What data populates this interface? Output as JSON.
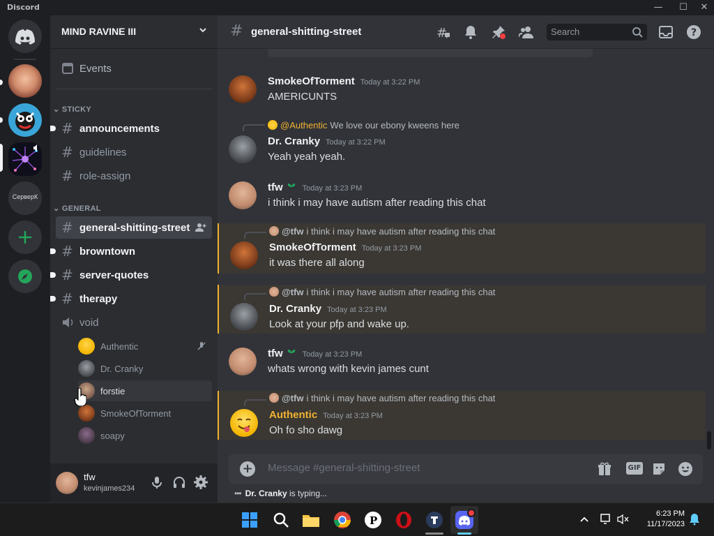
{
  "app": {
    "title": "Discord"
  },
  "window_controls": {
    "minimize": "—",
    "maximize": "☐",
    "close": "✕"
  },
  "guilds": [
    {
      "name": "Direct Messages",
      "icon": "discord-logo-icon"
    },
    {
      "name": "server-1",
      "icon": "avatar-face"
    },
    {
      "name": "server-2",
      "icon": "avatar-cartoon"
    },
    {
      "name": "server-3",
      "icon": "avatar-network"
    },
    {
      "name": "СерверК",
      "label": "СерверК"
    },
    {
      "name": "Add a Server",
      "icon": "plus-icon"
    },
    {
      "name": "Explore Servers",
      "icon": "compass-icon"
    }
  ],
  "server": {
    "name": "MIND RAVINE III"
  },
  "sidebar": {
    "events_label": "Events",
    "categories": [
      {
        "name": "STICKY",
        "channels": [
          "announcements",
          "guidelines",
          "role-assign"
        ]
      },
      {
        "name": "GENERAL",
        "channels": [
          "general-shitting-street",
          "browntown",
          "server-quotes",
          "therapy",
          "void"
        ]
      }
    ],
    "voice_users": [
      "Authentic",
      "Dr. Cranky",
      "forstie",
      "SmokeOfTorment",
      "soapy"
    ]
  },
  "user_panel": {
    "name": "tfw",
    "tag": "kevinjames234"
  },
  "channel": {
    "name": "general-shitting-street",
    "search_placeholder": "Search"
  },
  "messages": [
    {
      "author": "SmokeOfTorment",
      "time": "Today at 3:22 PM",
      "text": "AMERICUNTS"
    },
    {
      "reply_to": "@Authentic",
      "reply_text": "We love our ebony kweens here",
      "author": "Dr. Cranky",
      "time": "Today at 3:22 PM",
      "text": "Yeah yeah yeah."
    },
    {
      "author": "tfw",
      "time": "Today at 3:23 PM",
      "text": "i think i may have autism after reading this chat"
    },
    {
      "reply_to": "@tfw",
      "reply_text": "i think i may have autism after reading this chat",
      "author": "SmokeOfTorment",
      "time": "Today at 3:23 PM",
      "text": "it was there all along"
    },
    {
      "reply_to": "@tfw",
      "reply_text": "i think i may have autism after reading this chat",
      "author": "Dr. Cranky",
      "time": "Today at 3:23 PM",
      "text": "Look at your pfp and wake up."
    },
    {
      "author": "tfw",
      "time": "Today at 3:23 PM",
      "text": "whats wrong with kevin james cunt"
    },
    {
      "reply_to": "@tfw",
      "reply_text": "i think i may have autism after reading this chat",
      "author": "Authentic",
      "time": "Today at 3:23 PM",
      "text": "Oh fo sho dawg"
    }
  ],
  "composer": {
    "placeholder": "Message #general-shitting-street",
    "gif_label": "GIF"
  },
  "typing": {
    "user": "Dr. Cranky",
    "suffix": " is typing..."
  },
  "taskbar": {
    "time": "6:23 PM",
    "date": "11/17/2023"
  },
  "colors": {
    "accent": "#5865f2",
    "mention_bg": "#3b3833",
    "mention_bar": "#f0b232",
    "authentic_name": "#f0b232",
    "online": "#23a55a"
  }
}
